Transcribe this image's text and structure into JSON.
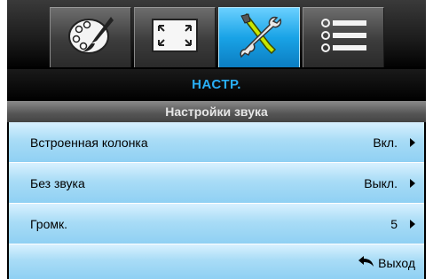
{
  "tabs": [
    {
      "icon": "palette-icon",
      "active": false
    },
    {
      "icon": "screen-icon",
      "active": false
    },
    {
      "icon": "tools-icon",
      "active": true
    },
    {
      "icon": "list-icon",
      "active": false
    }
  ],
  "menu": {
    "title": "НАСТР.",
    "subtitle": "Настройки звука"
  },
  "rows": [
    {
      "label": "Встроенная колонка",
      "value": "Вкл."
    },
    {
      "label": "Без звука",
      "value": "Выкл."
    },
    {
      "label": "Громк.",
      "value": "5"
    }
  ],
  "footer": {
    "exit_label": "Выход"
  },
  "colors": {
    "accent": "#29aef5",
    "active_tab": "#19a3e6",
    "row_bg": "#a9dcf6"
  }
}
